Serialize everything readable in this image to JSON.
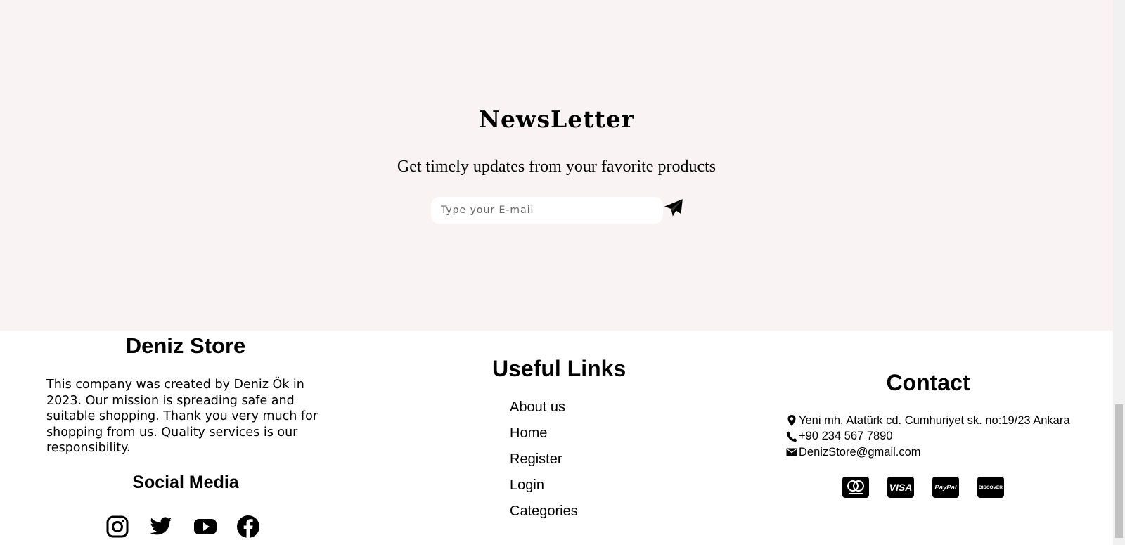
{
  "newsletter": {
    "title": "NewsLetter",
    "subtitle": "Get timely updates from your favorite products",
    "email_placeholder": "Type your E-mail",
    "send_icon": "paper-plane-icon"
  },
  "about": {
    "store_name": "Deniz Store",
    "description": "This company was created by Deniz Ök in 2023. Our mission is spreading safe and suitable shopping. Thank you very much for shopping from us. Quality services is our responsibility.",
    "social_title": "Social Media",
    "social_icons": [
      "instagram-icon",
      "twitter-icon",
      "youtube-icon",
      "facebook-icon"
    ]
  },
  "links": {
    "title": "Useful Links",
    "items": [
      "About us",
      "Home",
      "Register",
      "Login",
      "Categories"
    ]
  },
  "contact": {
    "title": "Contact",
    "address": "Yeni mh. Atatürk cd. Cumhuriyet sk. no:19/23 Ankara",
    "phone": "+90 234 567 7890",
    "email": "DenizStore@gmail.com",
    "payment_icons": [
      "mastercard-icon",
      "visa-icon",
      "paypal-icon",
      "discover-icon"
    ],
    "visa_label": "VISA",
    "paypal_label": "PayPal",
    "discover_label": "DISCOVER"
  },
  "colors": {
    "newsletter_bg": "#f9f4f3",
    "text": "#000000",
    "card_bg": "#000000"
  }
}
